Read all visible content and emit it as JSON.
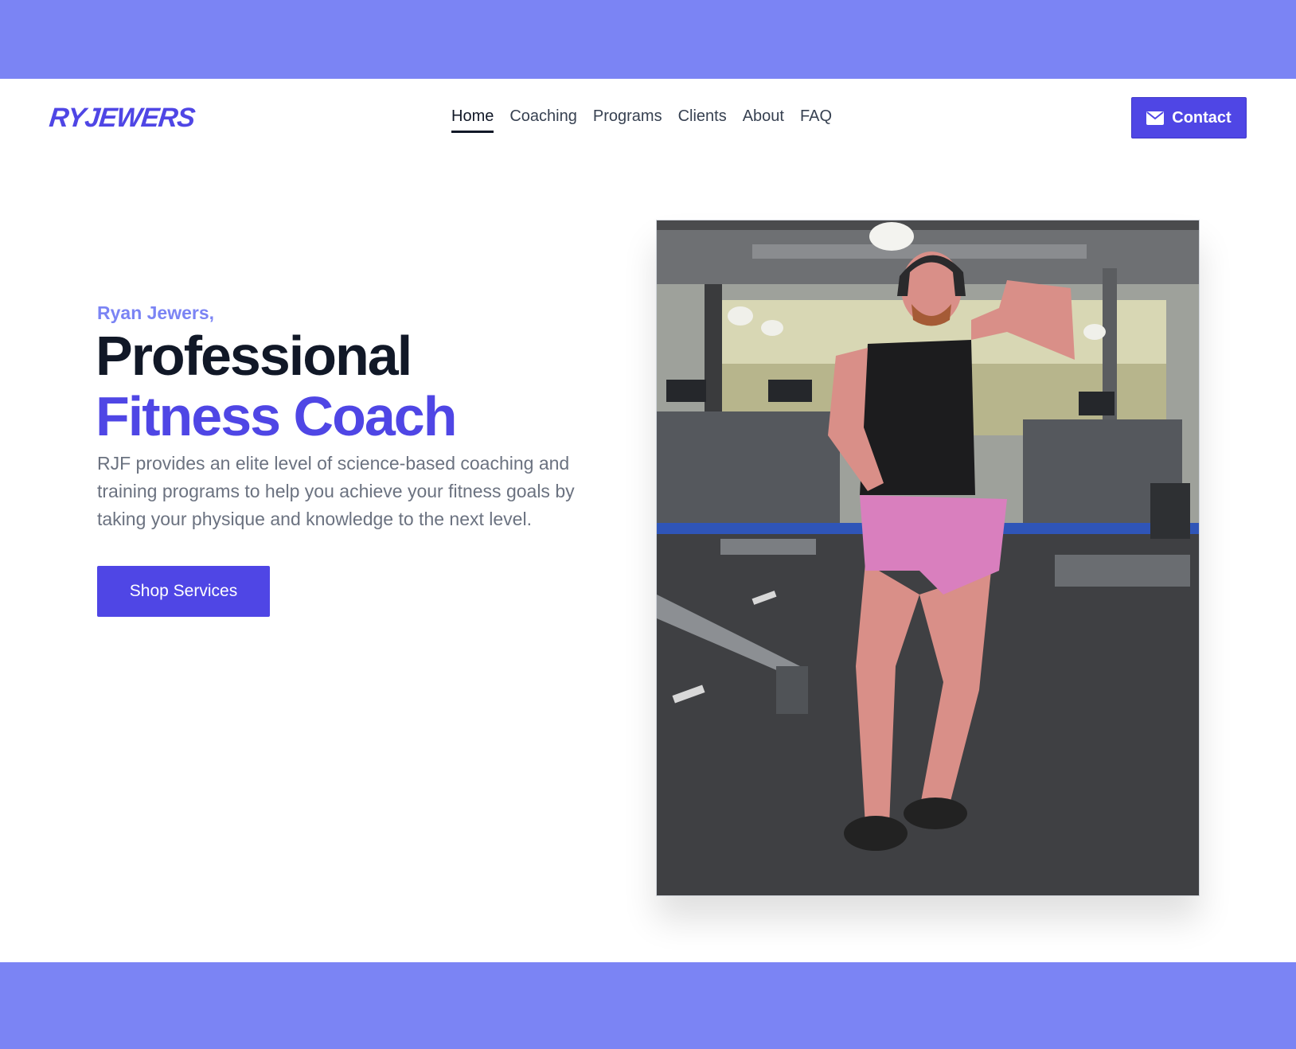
{
  "header": {
    "logo_text": "RYJEWERS",
    "nav": [
      {
        "label": "Home",
        "active": true
      },
      {
        "label": "Coaching",
        "active": false
      },
      {
        "label": "Programs",
        "active": false
      },
      {
        "label": "Clients",
        "active": false
      },
      {
        "label": "About",
        "active": false
      },
      {
        "label": "FAQ",
        "active": false
      }
    ],
    "contact_label": "Contact",
    "contact_icon": "envelope-icon"
  },
  "hero": {
    "eyebrow": "Ryan Jewers,",
    "headline_line1": "Professional",
    "headline_line2": "Fitness Coach",
    "description": "RJF provides an elite level of science-based coaching and training programs to help you achieve your fitness goals by taking your physique and knowledge to the next level.",
    "cta_label": "Shop Services"
  },
  "colors": {
    "frame": "#7b84f4",
    "accent": "#4f46e5",
    "eyebrow": "#7b84f4",
    "heading": "#111827",
    "body_text": "#6b7280"
  }
}
